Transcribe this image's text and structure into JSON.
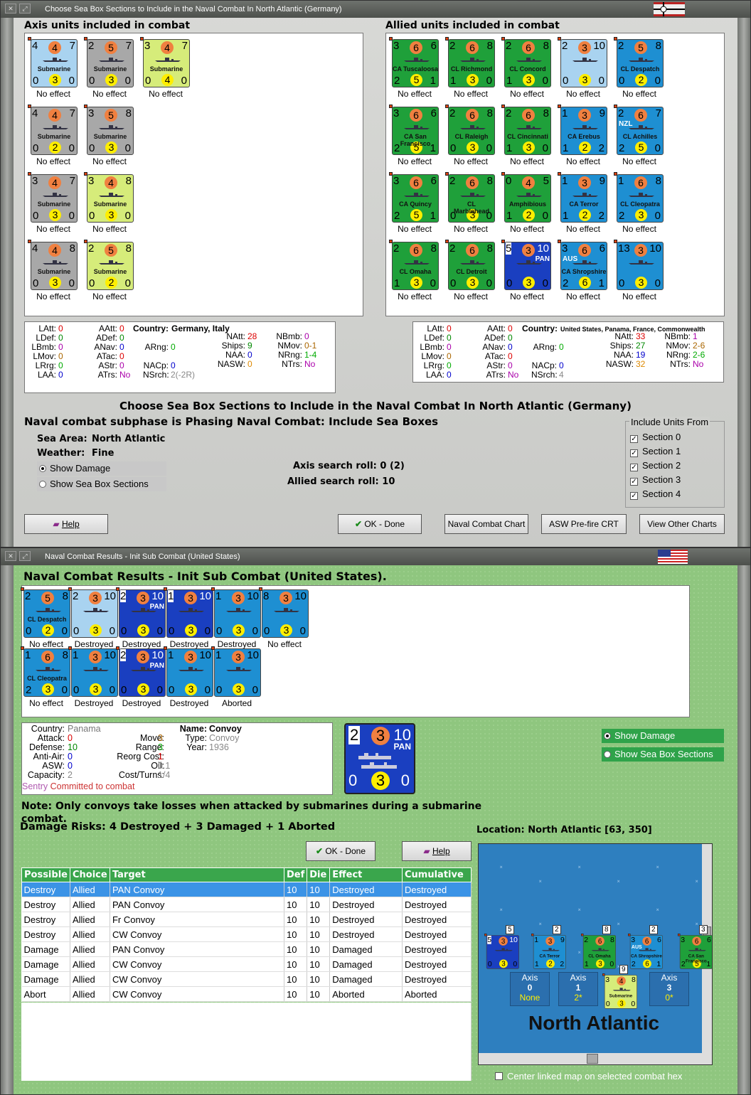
{
  "win1": {
    "title": "Choose Sea Box Sections to Include in the Naval Combat In North Atlantic (Germany)",
    "axis_header": "Axis units included in combat",
    "allied_header": "Allied units included in combat",
    "axis_units": [
      {
        "tl": "4",
        "tm": "4",
        "tr": "7",
        "name": "Submarine",
        "bl": "0",
        "bm": "3",
        "br": "0",
        "effect": "No effect",
        "color": "#a9d3f0"
      },
      {
        "tl": "2",
        "tm": "5",
        "tr": "7",
        "name": "Submarine",
        "bl": "0",
        "bm": "3",
        "br": "0",
        "effect": "No effect",
        "color": "#a8a8a8"
      },
      {
        "tl": "3",
        "tm": "4",
        "tr": "7",
        "name": "Submarine",
        "bl": "0",
        "bm": "4",
        "br": "0",
        "effect": "No effect",
        "color": "#d6ec7a"
      },
      {
        "tl": "4",
        "tm": "4",
        "tr": "7",
        "name": "Submarine",
        "bl": "0",
        "bm": "2",
        "br": "0",
        "effect": "No effect",
        "color": "#a8a8a8"
      },
      {
        "tl": "3",
        "tm": "5",
        "tr": "8",
        "name": "Submarine",
        "bl": "0",
        "bm": "3",
        "br": "0",
        "effect": "No effect",
        "color": "#a8a8a8"
      },
      {
        "tl": "3",
        "tm": "4",
        "tr": "7",
        "name": "Submarine",
        "bl": "0",
        "bm": "3",
        "br": "0",
        "effect": "No effect",
        "color": "#a8a8a8"
      },
      {
        "tl": "3",
        "tm": "4",
        "tr": "8",
        "name": "Submarine",
        "bl": "0",
        "bm": "3",
        "br": "0",
        "effect": "No effect",
        "color": "#d6ec7a"
      },
      {
        "tl": "4",
        "tm": "4",
        "tr": "8",
        "name": "Submarine",
        "bl": "0",
        "bm": "3",
        "br": "0",
        "effect": "No effect",
        "color": "#a8a8a8"
      },
      {
        "tl": "2",
        "tm": "5",
        "tr": "8",
        "name": "Submarine",
        "bl": "0",
        "bm": "2",
        "br": "0",
        "effect": "No effect",
        "color": "#d6ec7a"
      }
    ],
    "allied_units": [
      {
        "tl": "3",
        "tm": "6",
        "tr": "6",
        "name": "CA Tuscaloosa",
        "bl": "2",
        "bm": "5",
        "br": "1",
        "effect": "No effect",
        "color": "#1fa03a"
      },
      {
        "tl": "2",
        "tm": "6",
        "tr": "8",
        "name": "CL Richmond",
        "bl": "1",
        "bm": "3",
        "br": "0",
        "effect": "No effect",
        "color": "#1fa03a"
      },
      {
        "tl": "2",
        "tm": "6",
        "tr": "8",
        "name": "CL Concord",
        "bl": "1",
        "bm": "3",
        "br": "0",
        "effect": "No effect",
        "color": "#1fa03a"
      },
      {
        "tl": "2",
        "tm": "3",
        "tr": "10",
        "name": "",
        "bl": "0",
        "bm": "3",
        "br": "0",
        "effect": "No effect",
        "color": "#a9d3f0"
      },
      {
        "tl": "2",
        "tm": "5",
        "tr": "8",
        "name": "CL Despatch",
        "bl": "0",
        "bm": "2",
        "br": "0",
        "effect": "No effect",
        "color": "#1e8fd2"
      },
      {
        "tl": "3",
        "tm": "6",
        "tr": "6",
        "name": "CA San Francisco",
        "bl": "2",
        "bm": "5",
        "br": "1",
        "effect": "No effect",
        "color": "#1fa03a"
      },
      {
        "tl": "2",
        "tm": "6",
        "tr": "8",
        "name": "CL Raleigh",
        "bl": "0",
        "bm": "3",
        "br": "0",
        "effect": "No effect",
        "color": "#1fa03a"
      },
      {
        "tl": "2",
        "tm": "6",
        "tr": "8",
        "name": "CL Cincinnati",
        "bl": "1",
        "bm": "3",
        "br": "0",
        "effect": "No effect",
        "color": "#1fa03a"
      },
      {
        "tl": "1",
        "tm": "3",
        "tr": "9",
        "name": "CA Erebus",
        "bl": "1",
        "bm": "2",
        "br": "2",
        "effect": "No effect",
        "color": "#1e8fd2"
      },
      {
        "tl": "2",
        "tm": "6",
        "tr": "7",
        "name": "CL Achilles",
        "bl": "2",
        "bm": "5",
        "br": "0",
        "effect": "No effect",
        "color": "#1e8fd2",
        "tag": "NZL"
      },
      {
        "tl": "3",
        "tm": "6",
        "tr": "6",
        "name": "CA Quincy",
        "bl": "2",
        "bm": "5",
        "br": "1",
        "effect": "No effect",
        "color": "#1fa03a"
      },
      {
        "tl": "2",
        "tm": "6",
        "tr": "8",
        "name": "CL Marblehead",
        "bl": "0",
        "bm": "3",
        "br": "0",
        "effect": "No effect",
        "color": "#1fa03a"
      },
      {
        "tl": "0",
        "tm": "4",
        "tr": "5",
        "name": "Amphibious",
        "bl": "1",
        "bm": "2",
        "br": "0",
        "effect": "No effect",
        "color": "#1fa03a"
      },
      {
        "tl": "1",
        "tm": "3",
        "tr": "9",
        "name": "CA Terror",
        "bl": "1",
        "bm": "2",
        "br": "2",
        "effect": "No effect",
        "color": "#1e8fd2"
      },
      {
        "tl": "1",
        "tm": "6",
        "tr": "8",
        "name": "CL Cleopatra",
        "bl": "2",
        "bm": "3",
        "br": "0",
        "effect": "No effect",
        "color": "#1e8fd2"
      },
      {
        "tl": "2",
        "tm": "6",
        "tr": "8",
        "name": "CL Omaha",
        "bl": "1",
        "bm": "3",
        "br": "0",
        "effect": "No effect",
        "color": "#1fa03a"
      },
      {
        "tl": "2",
        "tm": "6",
        "tr": "8",
        "name": "CL Detroit",
        "bl": "0",
        "bm": "3",
        "br": "0",
        "effect": "No effect",
        "color": "#1fa03a"
      },
      {
        "tl": "5",
        "tm": "3",
        "tr": "10",
        "name": "",
        "bl": "0",
        "bm": "3",
        "br": "0",
        "effect": "No effect",
        "color": "#1a3fc0",
        "tag": "PAN"
      },
      {
        "tl": "3",
        "tm": "6",
        "tr": "6",
        "name": "CA Shropshire",
        "bl": "2",
        "bm": "6",
        "br": "1",
        "effect": "No effect",
        "color": "#1e8fd2",
        "tag": "AUS"
      },
      {
        "tl": "13",
        "tm": "3",
        "tr": "10",
        "name": "",
        "bl": "0",
        "bm": "3",
        "br": "0",
        "effect": "No effect",
        "color": "#1e8fd2"
      }
    ],
    "axis_stats": {
      "latt": "0",
      "ldef": "0",
      "lbmb": "0",
      "lmov": "0",
      "lrg": "0",
      "laa": "0",
      "aatt": "0",
      "adef": "0",
      "anav": "0",
      "atac": "0",
      "astr": "0",
      "atrs": "No",
      "country_label": "Country:",
      "country": "Germany, Italy",
      "arng": "0",
      "nacp": "0",
      "nsrch": "2(-2R)",
      "natt": "28",
      "ships": "9",
      "naa": "0",
      "nasw": "0",
      "nbmb": "0",
      "nmov": "0-1",
      "nrng": "1-4",
      "ntrs": "No"
    },
    "allied_stats": {
      "latt": "0",
      "ldef": "0",
      "lbmb": "0",
      "lmov": "0",
      "lrg": "0",
      "laa": "0",
      "aatt": "0",
      "adef": "0",
      "anav": "0",
      "atac": "0",
      "astr": "0",
      "atrs": "No",
      "country_label": "Country:",
      "country": "United States, Panama, France, Commonwealth",
      "arng": "0",
      "nacp": "0",
      "nsrch": "4",
      "natt": "33",
      "ships": "27",
      "naa": "19",
      "nasw": "32",
      "nbmb": "1",
      "nmov": "2-6",
      "nrng": "2-6",
      "ntrs": "No"
    },
    "big_title": "Choose Sea Box Sections to Include in the Naval Combat In North Atlantic (Germany)",
    "subphase": "Naval combat subphase is Phasing Naval Combat: Include Sea Boxes",
    "sea_area_label": "Sea Area:",
    "sea_area": "North Atlantic",
    "weather_label": "Weather:",
    "weather": "Fine",
    "show_damage": "Show Damage",
    "show_sections": "Show Sea Box Sections",
    "axis_roll": "Axis search roll: 0 (2)",
    "allied_roll": "Allied search roll: 10",
    "include_label": "Include Units From",
    "sections": [
      "Section 0",
      "Section 1",
      "Section 2",
      "Section 3",
      "Section 4"
    ],
    "help": "Help",
    "ok": "OK - Done",
    "naval_chart": "Naval Combat Chart",
    "asw_crt": "ASW Pre-fire CRT",
    "other_charts": "View Other Charts"
  },
  "win2": {
    "title": "Naval Combat Results - Init Sub Combat (United States)",
    "header": "Naval Combat Results - Init Sub Combat (United States).",
    "units": [
      {
        "tl": "2",
        "tm": "5",
        "tr": "8",
        "name": "CL Despatch",
        "bl": "0",
        "bm": "2",
        "br": "0",
        "effect": "No effect",
        "color": "#1e8fd2"
      },
      {
        "tl": "2",
        "tm": "3",
        "tr": "10",
        "name": "",
        "bl": "0",
        "bm": "3",
        "br": "0",
        "effect": "Destroyed",
        "color": "#a9d3f0"
      },
      {
        "tl": "2",
        "tm": "3",
        "tr": "10",
        "name": "",
        "bl": "0",
        "bm": "3",
        "br": "0",
        "effect": "Destroyed",
        "color": "#1a3fc0",
        "tag": "PAN"
      },
      {
        "tl": "1",
        "tm": "3",
        "tr": "10",
        "name": "",
        "bl": "0",
        "bm": "3",
        "br": "0",
        "effect": "Destroyed",
        "color": "#1a3fc0"
      },
      {
        "tl": "1",
        "tm": "3",
        "tr": "10",
        "name": "",
        "bl": "0",
        "bm": "3",
        "br": "0",
        "effect": "Destroyed",
        "color": "#1e8fd2"
      },
      {
        "tl": "8",
        "tm": "3",
        "tr": "10",
        "name": "",
        "bl": "0",
        "bm": "3",
        "br": "0",
        "effect": "No effect",
        "color": "#1e8fd2"
      },
      {
        "tl": "1",
        "tm": "6",
        "tr": "8",
        "name": "CL Cleopatra",
        "bl": "2",
        "bm": "3",
        "br": "0",
        "effect": "No effect",
        "color": "#1e8fd2"
      },
      {
        "tl": "1",
        "tm": "3",
        "tr": "10",
        "name": "",
        "bl": "0",
        "bm": "3",
        "br": "0",
        "effect": "Destroyed",
        "color": "#1e8fd2"
      },
      {
        "tl": "2",
        "tm": "3",
        "tr": "10",
        "name": "",
        "bl": "0",
        "bm": "3",
        "br": "0",
        "effect": "Destroyed",
        "color": "#1a3fc0",
        "tag": "PAN"
      },
      {
        "tl": "1",
        "tm": "3",
        "tr": "10",
        "name": "",
        "bl": "0",
        "bm": "3",
        "br": "0",
        "effect": "Destroyed",
        "color": "#1e8fd2"
      },
      {
        "tl": "1",
        "tm": "3",
        "tr": "10",
        "name": "",
        "bl": "0",
        "bm": "3",
        "br": "0",
        "effect": "Aborted",
        "color": "#1e8fd2"
      }
    ],
    "info": {
      "country_label": "Country:",
      "country": "Panama",
      "attack_label": "Attack:",
      "attack": "0",
      "defense_label": "Defense:",
      "defense": "10",
      "aa_label": "Anti-Air:",
      "aa": "0",
      "asw_label": "ASW:",
      "asw": "0",
      "cap_label": "Capacity:",
      "cap": "2",
      "move_label": "Move:",
      "move": "3",
      "range_label": "Range:",
      "range": "3",
      "reorg_label": "Reorg Cost:",
      "reorg": "1",
      "oil_label": "Oil:",
      "oil": "0.1",
      "cost_label": "Cost/Turns:",
      "cost": "1/4",
      "name_label": "Name:",
      "name": "Convoy",
      "type_label": "Type:",
      "type": "Convoy",
      "year_label": "Year:",
      "year": "1936",
      "sentry": "Sentry",
      "committed": "Committed to combat"
    },
    "big": {
      "tl": "2",
      "tm": "3",
      "tr": "10",
      "tag": "PAN",
      "bl": "0",
      "bm": "3",
      "br": "0"
    },
    "show_damage": "Show Damage",
    "show_sections": "Show Sea Box Sections",
    "note": "Note: Only convoys take losses when attacked by submarines during a submarine combat.",
    "damage_risks": "Damage Risks: 4 Destroyed + 3 Damaged + 1 Aborted",
    "location": "Location:  North Atlantic [63, 350]",
    "ok": "OK - Done",
    "help": "Help",
    "table_headers": [
      "Possible",
      "Choice",
      "Target",
      "Def",
      "Die",
      "Effect",
      "Cumulative"
    ],
    "table_rows": [
      [
        "Destroy",
        "Allied",
        "PAN Convoy",
        "10",
        "10",
        "Destroyed",
        "Destroyed"
      ],
      [
        "Destroy",
        "Allied",
        "PAN Convoy",
        "10",
        "10",
        "Destroyed",
        "Destroyed"
      ],
      [
        "Destroy",
        "Allied",
        "Fr Convoy",
        "10",
        "10",
        "Destroyed",
        "Destroyed"
      ],
      [
        "Destroy",
        "Allied",
        "CW Convoy",
        "10",
        "10",
        "Destroyed",
        "Destroyed"
      ],
      [
        "Damage",
        "Allied",
        "PAN Convoy",
        "10",
        "10",
        "Damaged",
        "Destroyed"
      ],
      [
        "Damage",
        "Allied",
        "CW Convoy",
        "10",
        "10",
        "Damaged",
        "Destroyed"
      ],
      [
        "Damage",
        "Allied",
        "CW Convoy",
        "10",
        "10",
        "Damaged",
        "Destroyed"
      ],
      [
        "Abort",
        "Allied",
        "CW Convoy",
        "10",
        "10",
        "Aborted",
        "Aborted"
      ]
    ],
    "map_title": "North Atlantic",
    "map_counts": [
      "5",
      "2",
      "8",
      "2",
      "3",
      "9"
    ],
    "map_units": [
      {
        "tl": "5",
        "tm": "3",
        "tr": "10",
        "name": "",
        "bl": "0",
        "bm": "3",
        "br": "0",
        "color": "#1a3fc0"
      },
      {
        "tl": "1",
        "tm": "3",
        "tr": "9",
        "name": "CA Terror",
        "bl": "1",
        "bm": "2",
        "br": "2",
        "color": "#1e8fd2"
      },
      {
        "tl": "2",
        "tm": "6",
        "tr": "8",
        "name": "CL Omaha",
        "bl": "1",
        "bm": "3",
        "br": "0",
        "color": "#1fa03a"
      },
      {
        "tl": "3",
        "tm": "6",
        "tr": "6",
        "name": "CA Shropshire",
        "bl": "2",
        "bm": "6",
        "br": "1",
        "color": "#1e8fd2",
        "tag": "AUS"
      },
      {
        "tl": "3",
        "tm": "6",
        "tr": "6",
        "name": "CA San Francisco",
        "bl": "2",
        "bm": "5",
        "br": "1",
        "color": "#1fa03a"
      }
    ],
    "map_sub": {
      "tl": "3",
      "tm": "4",
      "tr": "8",
      "name": "Submarine",
      "bl": "0",
      "bm": "3",
      "br": "0",
      "color": "#d6ec7a"
    },
    "axis_boxes": [
      {
        "label": "Axis",
        "val": "0",
        "sub": "None"
      },
      {
        "label": "Axis",
        "val": "1",
        "sub": "2*"
      },
      {
        "label": "Axis",
        "val": "3",
        "sub": "0*"
      }
    ],
    "center_linked": "Center linked map on selected combat hex"
  }
}
